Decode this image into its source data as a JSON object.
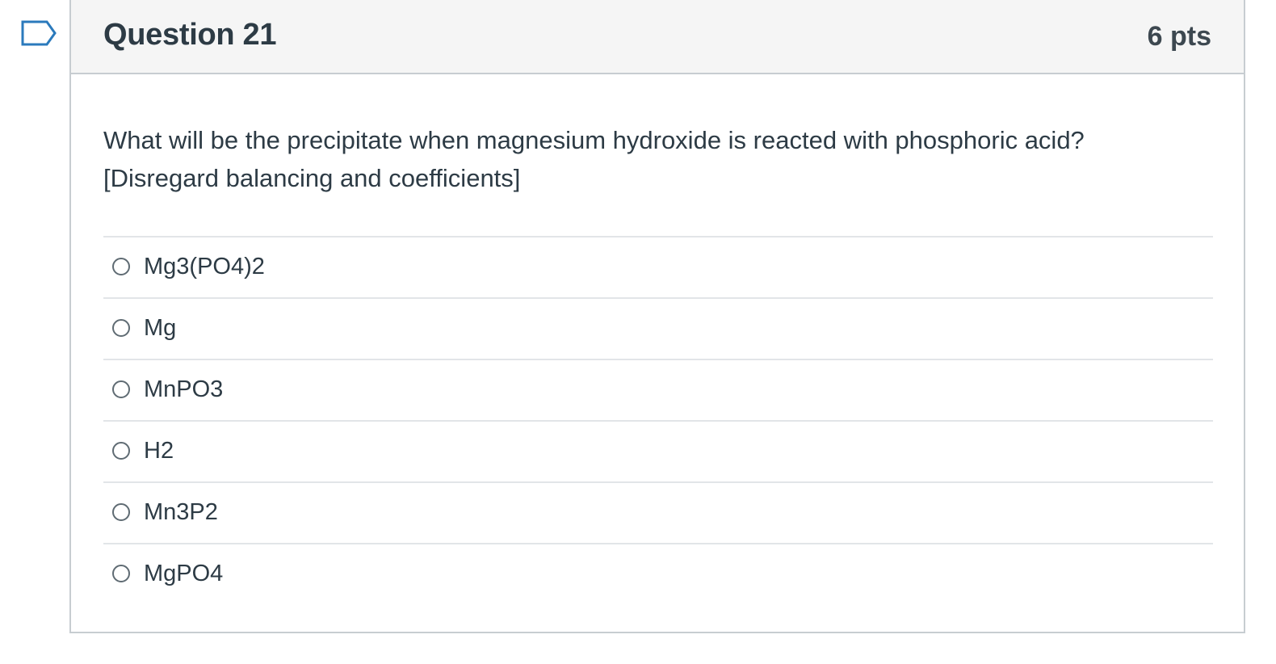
{
  "flag": {
    "icon": "flag-icon"
  },
  "question": {
    "title": "Question 21",
    "points": "6 pts",
    "text_line1": "What will be the precipitate when magnesium hydroxide is reacted with phosphoric acid?",
    "text_line2": "[Disregard balancing and coefficients]"
  },
  "answers": [
    {
      "label": "Mg3(PO4)2"
    },
    {
      "label": "Mg"
    },
    {
      "label": "MnPO3"
    },
    {
      "label": "H2"
    },
    {
      "label": "Mn3P2"
    },
    {
      "label": "MgPO4"
    }
  ],
  "colors": {
    "header_bg": "#f5f5f5",
    "border": "#c7cdd1",
    "flag": "#2b7abc",
    "text": "#2d3b45"
  }
}
